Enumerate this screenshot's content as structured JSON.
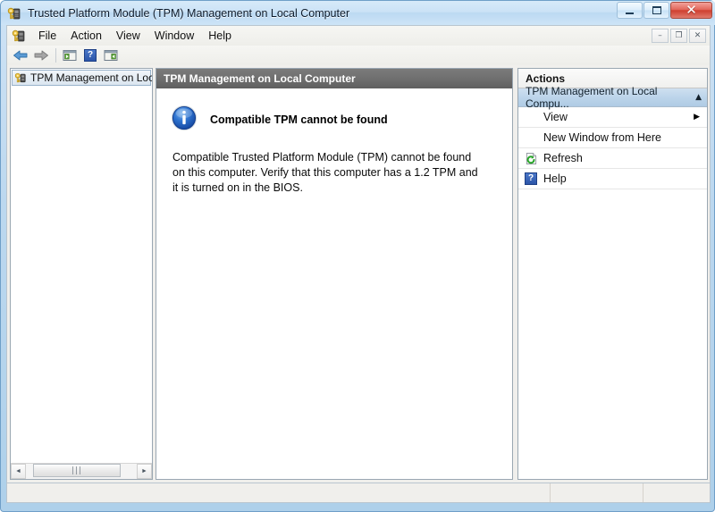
{
  "window": {
    "title": "Trusted Platform Module (TPM) Management on Local Computer",
    "app_icon": "tpm-key-icon",
    "controls": {
      "minimize": "minimize-button",
      "maximize": "maximize-button",
      "close_glyph": "✕"
    }
  },
  "menubar": {
    "icon": "tpm-key-icon",
    "items": [
      {
        "label": "File"
      },
      {
        "label": "Action"
      },
      {
        "label": "View"
      },
      {
        "label": "Window"
      },
      {
        "label": "Help"
      }
    ],
    "mdi_buttons": [
      {
        "name": "mdi-minimize",
        "glyph": "–"
      },
      {
        "name": "mdi-restore",
        "glyph": "❐"
      },
      {
        "name": "mdi-close",
        "glyph": "✕"
      }
    ]
  },
  "toolbar": {
    "buttons": [
      {
        "name": "back-button",
        "icon": "left-arrow-icon",
        "tooltip": "Back"
      },
      {
        "name": "forward-button",
        "icon": "right-arrow-icon",
        "tooltip": "Forward"
      },
      {
        "name": "show-hide-tree-button",
        "icon": "hide-console-tree-icon",
        "tooltip": "Show/Hide Console Tree"
      },
      {
        "name": "help-button",
        "icon": "help-question-icon",
        "tooltip": "Help"
      },
      {
        "name": "show-hide-action-pane-button",
        "icon": "show-action-pane-icon",
        "tooltip": "Show/Hide Action Pane"
      }
    ]
  },
  "tree": {
    "items": [
      {
        "label": "TPM Management on Local",
        "icon": "tpm-key-icon",
        "selected": true
      }
    ],
    "scrollbar": {
      "left_arrow": "◄",
      "right_arrow": "►",
      "grip": "|||"
    }
  },
  "center": {
    "header": "TPM Management on Local Computer",
    "message": {
      "icon": "info-icon",
      "title": "Compatible TPM cannot be found",
      "body": "Compatible Trusted Platform Module (TPM) cannot be found on this computer. Verify that this computer has a 1.2 TPM and it is turned on in the BIOS."
    }
  },
  "actions": {
    "header": "Actions",
    "group": {
      "label": "TPM Management on Local Compu...",
      "chevron": "▲"
    },
    "items": [
      {
        "label": "View",
        "icon": null,
        "submenu_arrow": "▶"
      },
      {
        "label": "New Window from Here",
        "icon": null,
        "submenu_arrow": ""
      },
      {
        "label": "Refresh",
        "icon": "refresh-icon",
        "submenu_arrow": ""
      },
      {
        "label": "Help",
        "icon": "help-question-icon",
        "submenu_arrow": ""
      }
    ]
  },
  "statusbar": {
    "main": "",
    "cell2": "",
    "cell3": ""
  },
  "colors": {
    "frame": "#aed0ea",
    "header_dark": "#6f6f6f",
    "actions_group": "#bcd4ea",
    "info_blue": "#1f5fbf",
    "close_red": "#cf3f30"
  }
}
